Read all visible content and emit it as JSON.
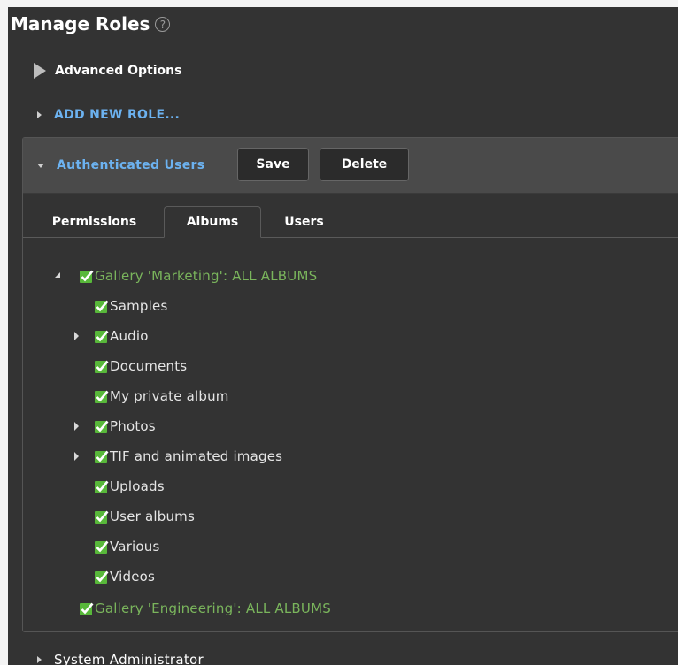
{
  "page": {
    "title": "Manage Roles",
    "help_glyph": "?"
  },
  "advanced_options": {
    "label": "Advanced Options"
  },
  "add_new_role": {
    "label": "ADD NEW ROLE..."
  },
  "role": {
    "name": "Authenticated Users",
    "save_label": "Save",
    "delete_label": "Delete",
    "tabs": [
      {
        "label": "Permissions",
        "active": false
      },
      {
        "label": "Albums",
        "active": true
      },
      {
        "label": "Users",
        "active": false
      }
    ],
    "tree": {
      "galleries": [
        {
          "label": "Gallery 'Marketing': ALL ALBUMS",
          "checked": true,
          "expanded": true,
          "albums": [
            {
              "label": "Samples",
              "expandable": false,
              "checked": true
            },
            {
              "label": "Audio",
              "expandable": true,
              "checked": true
            },
            {
              "label": "Documents",
              "expandable": false,
              "checked": true
            },
            {
              "label": "My private album",
              "expandable": false,
              "checked": true
            },
            {
              "label": "Photos",
              "expandable": true,
              "checked": true
            },
            {
              "label": "TIF and animated images",
              "expandable": true,
              "checked": true
            },
            {
              "label": "Uploads",
              "expandable": false,
              "checked": true
            },
            {
              "label": "User albums",
              "expandable": false,
              "checked": true
            },
            {
              "label": "Various",
              "expandable": false,
              "checked": true
            },
            {
              "label": "Videos",
              "expandable": false,
              "checked": true
            }
          ]
        },
        {
          "label": "Gallery 'Engineering': ALL ALBUMS",
          "checked": true,
          "expanded": false
        }
      ]
    }
  },
  "other_roles": [
    {
      "label": "System Administrator"
    }
  ],
  "colors": {
    "panel_bg": "#333333",
    "header_bg": "#4a4a4a",
    "link_blue": "#6cb2f0",
    "gallery_green": "#7ab55c",
    "check_green": "#5cc63c"
  }
}
